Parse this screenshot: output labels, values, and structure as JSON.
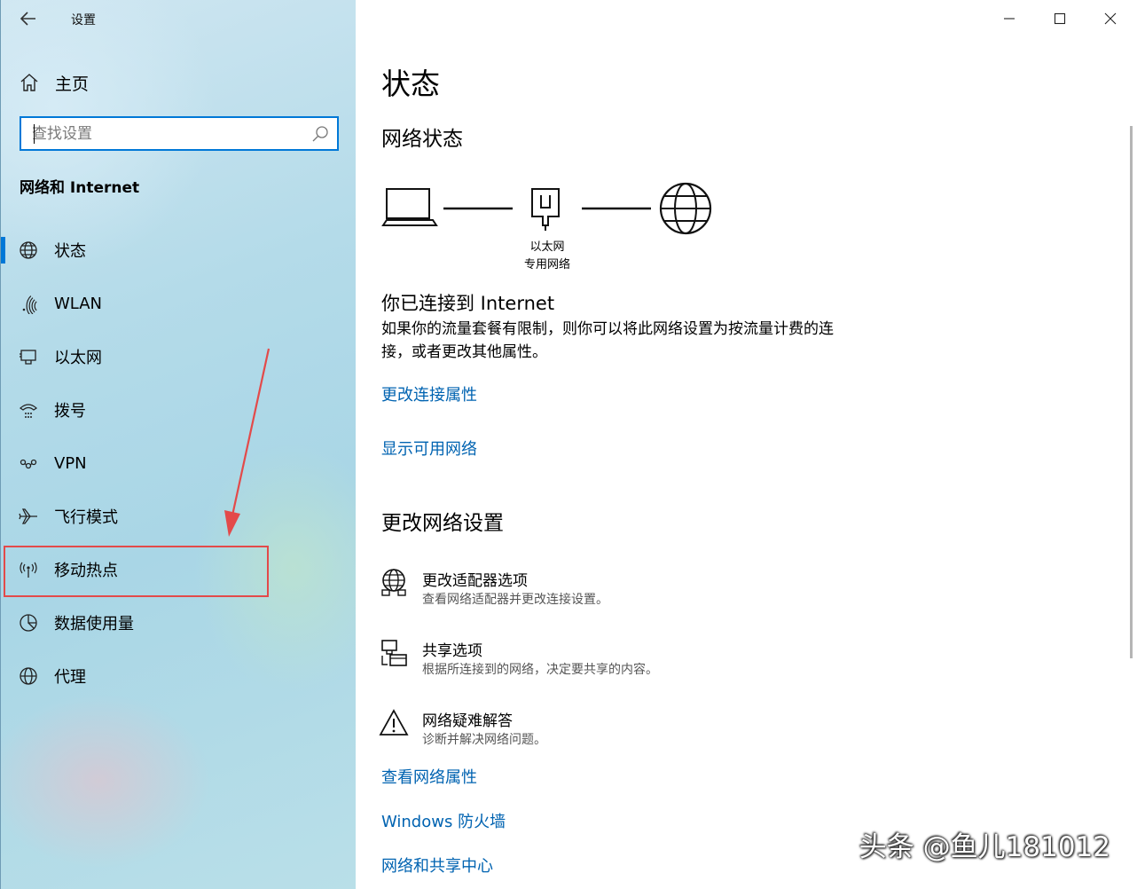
{
  "window": {
    "title": "设置",
    "controls": {
      "minimize": "minimize-icon",
      "maximize": "maximize-icon",
      "close": "close-icon"
    }
  },
  "sidebar": {
    "home_label": "主页",
    "search_placeholder": "查找设置",
    "section_title": "网络和 Internet",
    "items": [
      {
        "label": "状态",
        "icon": "globe-status-icon",
        "active": true
      },
      {
        "label": "WLAN",
        "icon": "wifi-icon"
      },
      {
        "label": "以太网",
        "icon": "ethernet-icon"
      },
      {
        "label": "拨号",
        "icon": "dialup-icon"
      },
      {
        "label": "VPN",
        "icon": "vpn-icon"
      },
      {
        "label": "飞行模式",
        "icon": "airplane-icon"
      },
      {
        "label": "移动热点",
        "icon": "hotspot-icon",
        "highlighted": true
      },
      {
        "label": "数据使用量",
        "icon": "data-usage-icon"
      },
      {
        "label": "代理",
        "icon": "proxy-globe-icon"
      }
    ]
  },
  "main": {
    "page_title": "状态",
    "network_status_heading": "网络状态",
    "diagram": {
      "adapter_name": "以太网",
      "network_profile": "专用网络"
    },
    "connected_title": "你已连接到 Internet",
    "connected_desc": "如果你的流量套餐有限制，则你可以将此网络设置为按流量计费的连接，或者更改其他属性。",
    "link_change_properties": "更改连接属性",
    "link_show_networks": "显示可用网络",
    "change_settings_heading": "更改网络设置",
    "options": [
      {
        "title": "更改适配器选项",
        "desc": "查看网络适配器并更改连接设置。",
        "icon": "adapter-globe-icon"
      },
      {
        "title": "共享选项",
        "desc": "根据所连接到的网络，决定要共享的内容。",
        "icon": "sharing-icon"
      },
      {
        "title": "网络疑难解答",
        "desc": "诊断并解决网络问题。",
        "icon": "warning-icon"
      }
    ],
    "bottom_links": [
      "查看网络属性",
      "Windows 防火墙",
      "网络和共享中心"
    ]
  },
  "watermark": "头条 @鱼儿181012",
  "colors": {
    "accent": "#0078d7",
    "link": "#0063b1",
    "annotation_red": "#e34a4a"
  }
}
